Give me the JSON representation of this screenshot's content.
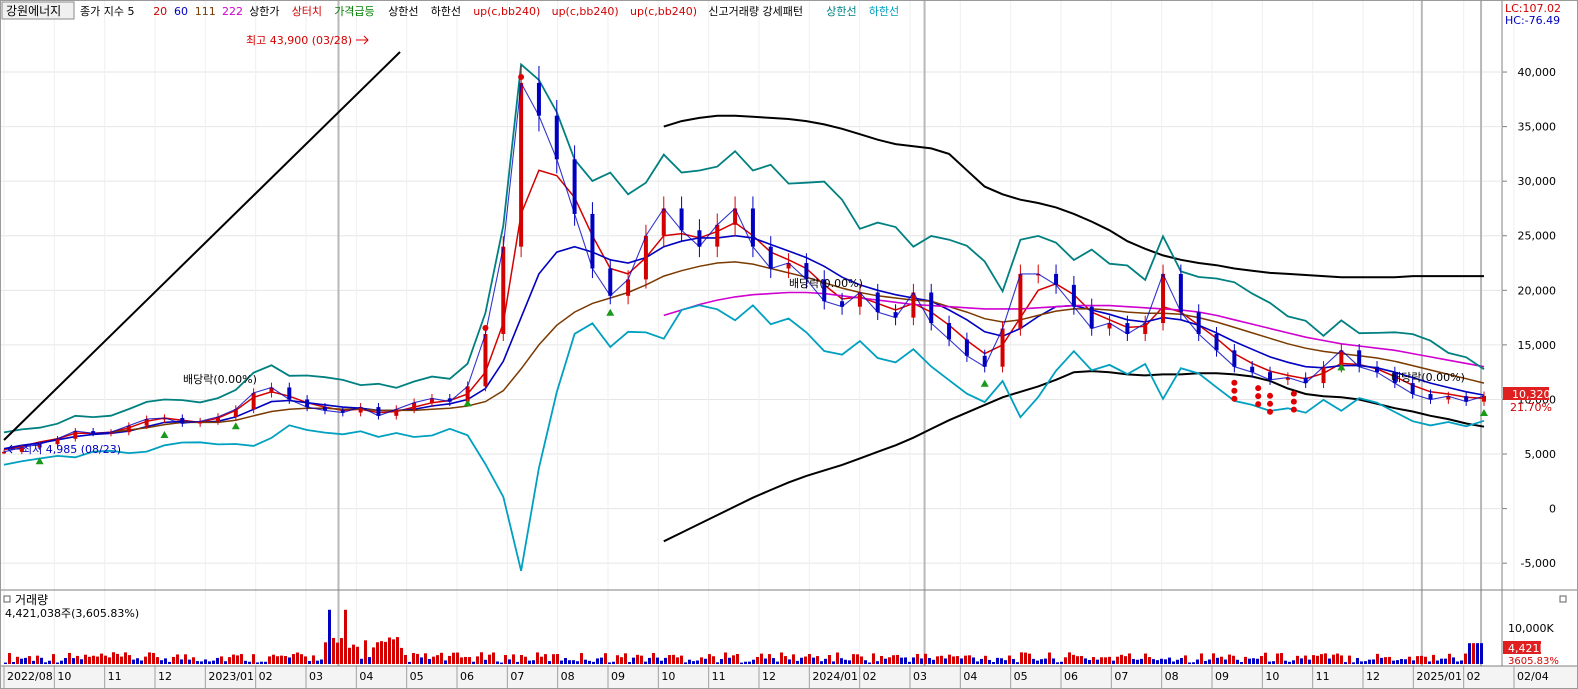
{
  "toolbar": {
    "stock_name": "강원에너지",
    "items": [
      {
        "text": "종가 지수 5",
        "color": "#000000"
      },
      {
        "text": "20",
        "color": "#d40000"
      },
      {
        "text": "60",
        "color": "#0000c0"
      },
      {
        "text": "111",
        "color": "#7a3a00"
      },
      {
        "text": "222",
        "color": "#d000d0"
      },
      {
        "text": "상한가",
        "color": "#000000"
      },
      {
        "text": "상터치",
        "color": "#d40000"
      },
      {
        "text": "가격급등",
        "color": "#008000"
      },
      {
        "text": "상한선",
        "color": "#000000"
      },
      {
        "text": "하한선",
        "color": "#000000"
      },
      {
        "text": "up(c,bb240)",
        "color": "#d40000"
      },
      {
        "text": "up(c,bb240)",
        "color": "#d40000"
      },
      {
        "text": "up(c,bb240)",
        "color": "#d40000"
      },
      {
        "text": "신고거래량 강세패턴",
        "color": "#000000"
      },
      {
        "text": "상한선",
        "color": "#008080"
      },
      {
        "text": "하한선",
        "color": "#00a0c0"
      }
    ],
    "lc_label": "LC:107.02",
    "hc_label": "HC:-76.49"
  },
  "annotations": {
    "high": "최고 43,900 (03/28)",
    "low": "최저 4,985 (08/23)",
    "dividend_1": "배당락(0.00%)",
    "dividend_2": "배당락(0.00%)",
    "dividend_3": "배당락(0.00%)"
  },
  "price_tags": {
    "last": "10,320",
    "pct": "21.70%"
  },
  "volume_panel": {
    "title": "거래량",
    "value": "4,421,038주(3,605.83%)",
    "axis_label": "10,000K",
    "tag_value": "4,421K",
    "tag_pct": "3605.83%"
  },
  "colors": {
    "price_up": "#d40000",
    "price_down": "#0000c0",
    "ma20": "#d40000",
    "ma60": "#0000c0",
    "ma111": "#7a3a00",
    "ma222": "#d000d0",
    "bb_upper": "#008080",
    "bb_lower": "#00a0c0",
    "envelope": "#000000",
    "tag_bg": "#e02020"
  },
  "chart_data": {
    "type": "line",
    "title": "강원에너지",
    "x_labels": [
      "2022/08",
      "10",
      "11",
      "12",
      "2023/01",
      "02",
      "03",
      "04",
      "05",
      "06",
      "07",
      "08",
      "09",
      "10",
      "11",
      "12",
      "2024/01",
      "02",
      "03",
      "04",
      "05",
      "06",
      "07",
      "08",
      "09",
      "10",
      "11",
      "12",
      "2025/01",
      "02",
      "02/04"
    ],
    "y_ticks": [
      -5000,
      0,
      5000,
      10000,
      15000,
      20000,
      25000,
      30000,
      35000,
      40000
    ],
    "y_tick_labels": [
      "-5,000",
      "0",
      "5,000",
      "10,000",
      "15,000",
      "20,000",
      "25,000",
      "30,000",
      "35,000",
      "40,000"
    ],
    "ylim": [
      -7000,
      45500
    ],
    "grid": true,
    "series": [
      {
        "name": "종가",
        "values": [
          5200,
          5600,
          5900,
          6400,
          7100,
          6900,
          7000,
          7600,
          8200,
          8300,
          7800,
          8000,
          8400,
          9100,
          10600,
          11100,
          10000,
          9300,
          9000,
          8800,
          9300,
          8500,
          9100,
          9700,
          10100,
          9800,
          11200,
          16000,
          24000,
          39000,
          36000,
          32000,
          27000,
          22000,
          19500,
          21000,
          25000,
          27500,
          25500,
          24000,
          26000,
          27500,
          24000,
          22000,
          22500,
          21000,
          19000,
          18500,
          19800,
          18000,
          17500,
          19800,
          17000,
          15500,
          14000,
          13000,
          16500,
          21500,
          21500,
          20500,
          18500,
          16500,
          17000,
          16000,
          17000,
          21500,
          18000,
          16000,
          14500,
          13000,
          12500,
          11800,
          12000,
          11500,
          13000,
          14500,
          13000,
          12500,
          11500,
          10500,
          10000,
          10300,
          9800,
          10320
        ]
      },
      {
        "name": "20",
        "values": [
          5400,
          5700,
          6100,
          6400,
          6900,
          6900,
          7000,
          7400,
          8000,
          8300,
          8100,
          7900,
          8300,
          9000,
          10200,
          10700,
          10300,
          9700,
          9300,
          9000,
          9100,
          8800,
          8900,
          9300,
          9700,
          9900,
          10500,
          12500,
          17000,
          27000,
          31000,
          30500,
          28500,
          25000,
          22000,
          21500,
          23000,
          25000,
          25200,
          24800,
          25400,
          26200,
          25000,
          23500,
          22800,
          22000,
          20500,
          19200,
          19400,
          18800,
          18200,
          18800,
          18000,
          16800,
          15400,
          14200,
          15000,
          17500,
          20000,
          20600,
          19600,
          18000,
          17300,
          16600,
          16700,
          18500,
          18000,
          16800,
          15600,
          14200,
          13300,
          12600,
          12200,
          11900,
          12400,
          13300,
          13200,
          12800,
          12100,
          11300,
          10700,
          10500,
          10200,
          10100
        ]
      },
      {
        "name": "60",
        "values": [
          5500,
          5800,
          6000,
          6300,
          6600,
          6800,
          6900,
          7100,
          7500,
          7900,
          8000,
          7900,
          8000,
          8400,
          9100,
          9800,
          9900,
          9700,
          9500,
          9300,
          9200,
          9000,
          9000,
          9100,
          9400,
          9600,
          10000,
          11000,
          13500,
          17500,
          21500,
          23500,
          24000,
          23500,
          22800,
          22500,
          23000,
          24000,
          24500,
          24800,
          24800,
          25000,
          24800,
          24200,
          23600,
          23000,
          22200,
          21200,
          20500,
          20000,
          19600,
          19300,
          19000,
          18200,
          17300,
          16200,
          15800,
          16500,
          17600,
          18500,
          18600,
          18200,
          17800,
          17300,
          17100,
          17500,
          17300,
          16800,
          16100,
          15300,
          14600,
          13900,
          13400,
          13000,
          12900,
          13100,
          13100,
          12900,
          12500,
          12000,
          11500,
          11100,
          10700,
          10400
        ]
      },
      {
        "name": "111",
        "values": [
          null,
          null,
          null,
          null,
          null,
          null,
          7000,
          7200,
          7400,
          7700,
          7900,
          7900,
          7900,
          8100,
          8500,
          8900,
          9100,
          9200,
          9200,
          9100,
          9100,
          9000,
          9000,
          9000,
          9100,
          9200,
          9400,
          9800,
          10800,
          12800,
          15000,
          16800,
          18000,
          18800,
          19300,
          19800,
          20500,
          21300,
          21800,
          22200,
          22500,
          22600,
          22400,
          22000,
          21600,
          21200,
          20700,
          20200,
          19800,
          19500,
          19300,
          19100,
          19000,
          18500,
          18000,
          17400,
          17100,
          17300,
          17700,
          18100,
          18300,
          18300,
          18200,
          18000,
          17900,
          17900,
          17800,
          17500,
          17100,
          16600,
          16100,
          15600,
          15100,
          14700,
          14400,
          14200,
          14000,
          13800,
          13500,
          13100,
          12700,
          12300,
          11900,
          11500
        ]
      },
      {
        "name": "222",
        "values": [
          null,
          null,
          null,
          null,
          null,
          null,
          null,
          null,
          null,
          null,
          null,
          null,
          null,
          null,
          null,
          null,
          null,
          null,
          null,
          null,
          null,
          null,
          null,
          null,
          null,
          null,
          null,
          null,
          null,
          null,
          null,
          null,
          null,
          null,
          null,
          null,
          null,
          17700,
          18200,
          18700,
          19100,
          19400,
          19600,
          19700,
          19800,
          19800,
          19700,
          19500,
          19300,
          19100,
          18900,
          18700,
          18600,
          18500,
          18400,
          18300,
          18300,
          18300,
          18400,
          18500,
          18600,
          18600,
          18600,
          18500,
          18400,
          18300,
          18200,
          18000,
          17700,
          17300,
          16900,
          16500,
          16100,
          15700,
          15400,
          15100,
          14900,
          14700,
          14500,
          14200,
          13900,
          13600,
          13300,
          13000
        ]
      },
      {
        "name": "상한선",
        "values": [
          null,
          null,
          null,
          null,
          null,
          null,
          null,
          null,
          null,
          null,
          null,
          null,
          null,
          null,
          null,
          null,
          null,
          null,
          null,
          null,
          null,
          null,
          null,
          null,
          null,
          null,
          null,
          null,
          null,
          null,
          null,
          null,
          null,
          null,
          null,
          null,
          null,
          35000,
          35500,
          35800,
          36000,
          36000,
          35900,
          35800,
          35700,
          35500,
          35200,
          34800,
          34300,
          33800,
          33400,
          33200,
          33000,
          32500,
          31000,
          29500,
          28800,
          28300,
          28000,
          27600,
          27000,
          26300,
          25500,
          24500,
          23800,
          23200,
          22800,
          22500,
          22300,
          22000,
          21800,
          21600,
          21500,
          21400,
          21300,
          21200,
          21200,
          21200,
          21200,
          21300,
          21300,
          21300,
          21300,
          21300
        ]
      },
      {
        "name": "하한선",
        "values": [
          null,
          null,
          null,
          null,
          null,
          null,
          null,
          null,
          null,
          null,
          null,
          null,
          null,
          null,
          null,
          null,
          null,
          null,
          null,
          null,
          null,
          null,
          null,
          null,
          null,
          null,
          null,
          null,
          null,
          null,
          null,
          null,
          null,
          null,
          null,
          null,
          null,
          -3000,
          -2200,
          -1400,
          -600,
          200,
          1000,
          1700,
          2400,
          3000,
          3500,
          4000,
          4600,
          5200,
          5800,
          6500,
          7300,
          8100,
          8800,
          9500,
          10200,
          10700,
          11200,
          11800,
          12500,
          12600,
          12500,
          12300,
          12200,
          12300,
          12300,
          12400,
          12400,
          12300,
          12100,
          11700,
          11000,
          10500,
          10300,
          10200,
          10000,
          9600,
          9200,
          8900,
          8500,
          8200,
          7800,
          7500
        ]
      }
    ],
    "volume_unit": "K",
    "volume_ylim": [
      0,
      14000
    ]
  }
}
